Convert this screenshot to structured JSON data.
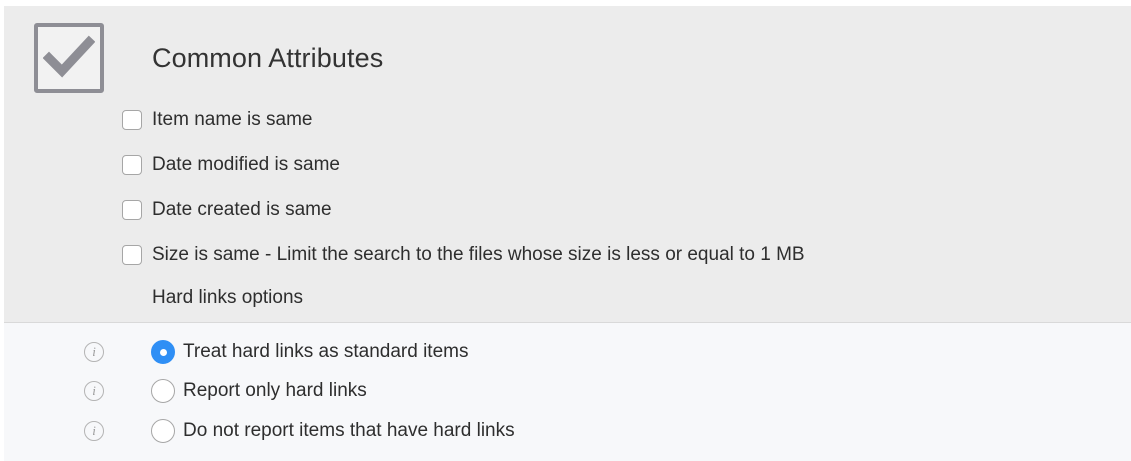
{
  "section": {
    "title": "Common Attributes",
    "checked": true,
    "options": [
      {
        "label": "Item name is same",
        "checked": false
      },
      {
        "label": "Date modified is same",
        "checked": false
      },
      {
        "label": "Date created is same",
        "checked": false
      },
      {
        "label": "Size is same - Limit the search to the files whose size is less or equal to 1 MB",
        "checked": false
      }
    ],
    "hard_links_header": "Hard links options"
  },
  "hard_links": {
    "info_glyph": "i",
    "options": [
      {
        "label": "Treat hard links as standard items",
        "selected": true
      },
      {
        "label": "Report only hard links",
        "selected": false
      },
      {
        "label": "Do not report items that have hard links",
        "selected": false
      }
    ]
  },
  "colors": {
    "accent": "#2f8ff5",
    "panel_top": "#ececec",
    "panel_bottom": "#f7f8fa"
  },
  "icons": [
    "checkmark-icon",
    "info-icon"
  ]
}
